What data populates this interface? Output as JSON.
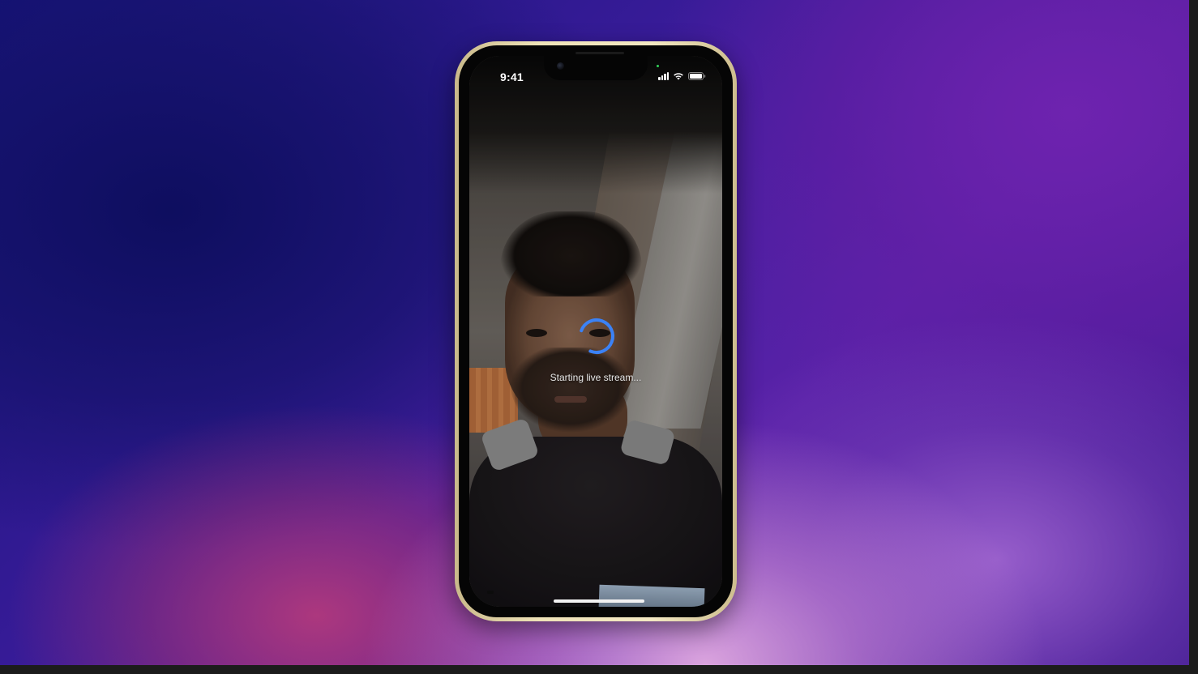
{
  "status_bar": {
    "time": "9:41"
  },
  "stream": {
    "loading_text": "Starting live stream..."
  },
  "icons": {
    "signal": "cellular-signal-icon",
    "wifi": "wifi-icon",
    "battery": "battery-icon",
    "spinner": "loading-spinner-icon"
  },
  "colors": {
    "spinner": "#3b82f6",
    "phone_frame": "#efe3b8",
    "mic_indicator": "#31d158"
  }
}
